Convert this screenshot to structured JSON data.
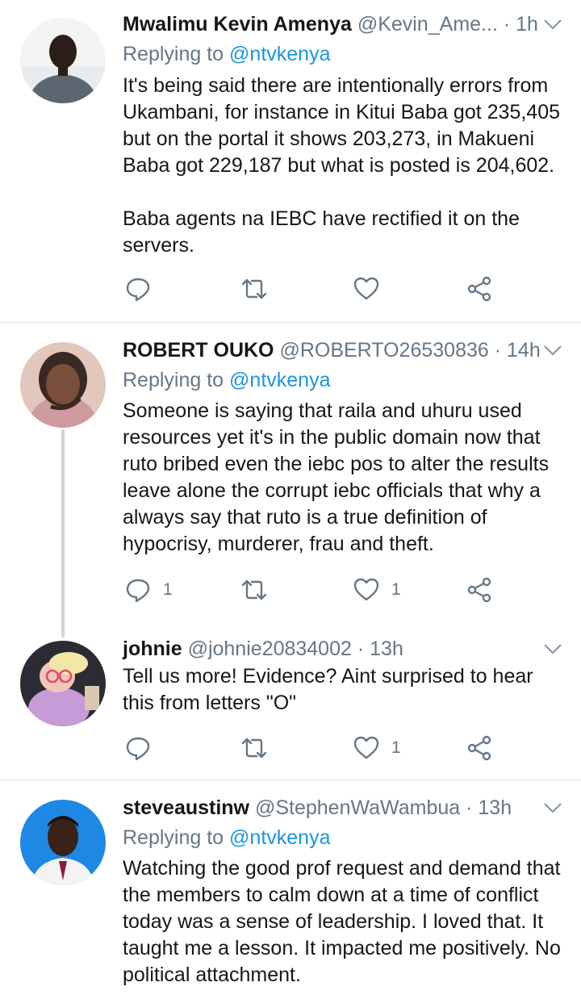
{
  "tweets": [
    {
      "name": "Mwalimu Kevin Amenya",
      "handle": "@Kevin_Ame...",
      "dot": "·",
      "time": "1h",
      "replying_prefix": "Replying to",
      "replying_to": "@ntvkenya",
      "text": "It's being said there are intentionally errors from Ukambani, for instance in Kitui Baba got 235,405 but on the portal it shows 203,273, in Makueni Baba got 229,187 but what is posted is 204,602.\n\nBaba agents na IEBC have rectified it on the servers.",
      "reply_count": "",
      "like_count": ""
    },
    {
      "name": "ROBERT OUKO",
      "handle": "@ROBERTO26530836",
      "dot": "·",
      "time": "14h",
      "replying_prefix": "Replying to",
      "replying_to": "@ntvkenya",
      "text": "Someone is saying that raila and uhuru used resources yet it's in the public domain now that ruto bribed even the iebc pos to alter the results leave alone the corrupt iebc officials that why a always say that ruto is a true definition of hypocrisy, murderer, frau and theft.",
      "reply_count": "1",
      "like_count": "1"
    },
    {
      "name": "johnie",
      "handle": "@johnie20834002",
      "dot": "·",
      "time": "13h",
      "text": "Tell us more! Evidence? Aint surprised to hear this from letters \"O\"",
      "reply_count": "",
      "like_count": "1"
    },
    {
      "name": "steveaustinw",
      "handle": "@StephenWaWambua",
      "dot": "·",
      "time": "13h",
      "replying_prefix": "Replying to",
      "replying_to": "@ntvkenya",
      "text": "Watching the good prof request and demand that the members to calm down at a time of conflict today was a sense of leadership. I loved that. It taught me a lesson. It impacted me positively. No political attachment."
    }
  ],
  "colors": {
    "link": "#1b95e0",
    "muted": "#657786",
    "text": "#14171a",
    "divider": "#dfe3e7"
  },
  "icons": [
    "reply-icon",
    "retweet-icon",
    "like-icon",
    "share-icon",
    "chevron-down-icon"
  ]
}
